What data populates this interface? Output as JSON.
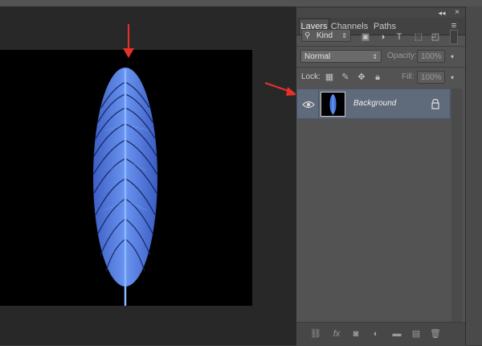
{
  "panel": {
    "tabs": [
      {
        "label": "Layers",
        "active": true
      },
      {
        "label": "Channels",
        "active": false
      },
      {
        "label": "Paths",
        "active": false
      }
    ],
    "filter": {
      "label": "Kind"
    },
    "blend_mode": "Normal",
    "opacity": {
      "label": "Opacity:",
      "value": "100%"
    },
    "lock": {
      "label": "Lock:"
    },
    "fill": {
      "label": "Fill:",
      "value": "100%"
    },
    "layers": [
      {
        "name": "Background",
        "visible": true,
        "locked": true
      }
    ],
    "bottom_icons": [
      "link-icon",
      "fx-icon",
      "mask-icon",
      "adjustment-icon",
      "folder-icon",
      "new-layer-icon",
      "trash-icon"
    ],
    "fx_label": "fx"
  },
  "colors": {
    "workspace": "#282828",
    "panel": "#535353",
    "selected_layer": "#5f6b7b",
    "annotation_arrow": "#e8302a",
    "feather": "#4a78e0"
  }
}
